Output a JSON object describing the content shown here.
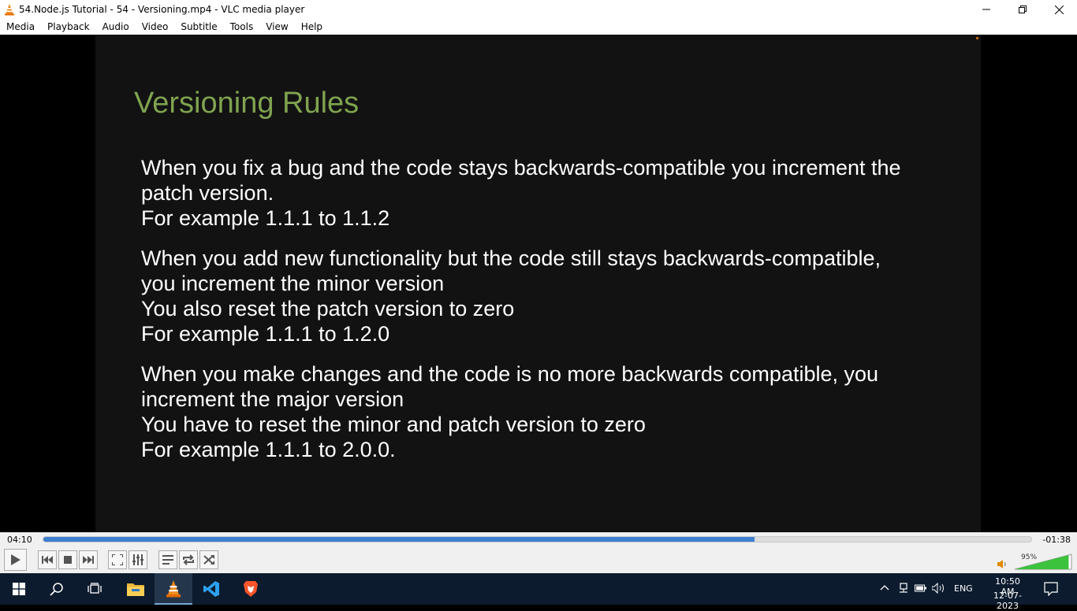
{
  "window": {
    "title": "54.Node.js Tutorial - 54 - Versioning.mp4 - VLC media player"
  },
  "menu": [
    "Media",
    "Playback",
    "Audio",
    "Video",
    "Subtitle",
    "Tools",
    "View",
    "Help"
  ],
  "slide": {
    "title": "Versioning Rules",
    "paragraphs": [
      [
        "When you fix a bug and the code stays backwards-compatible you increment the",
        "patch version.",
        "For example 1.1.1 to 1.1.2"
      ],
      [
        "When you add new functionality but the code still stays backwards-compatible,",
        "you increment the minor version",
        "You also reset the patch version to zero",
        "For example 1.1.1 to 1.2.0"
      ],
      [
        "When you make changes and the code is no more backwards compatible, you",
        "increment the major version",
        "You have to reset the minor and patch version to zero",
        "For example 1.1.1 to 2.0.0."
      ]
    ],
    "title_color": "#7fa34f"
  },
  "player": {
    "elapsed": "04:10",
    "remaining": "-01:38",
    "progress": 0.72,
    "volume_label": "95%",
    "volume": 0.95,
    "accent": "#3b7fd1"
  },
  "taskbar": {
    "apps": [
      "windows-start-icon",
      "search-icon",
      "task-view-icon",
      "file-explorer-icon",
      "vlc-icon",
      "vscode-icon",
      "brave-icon"
    ],
    "language": "ENG",
    "time": "10:50 AM",
    "date": "12-07-2023"
  }
}
